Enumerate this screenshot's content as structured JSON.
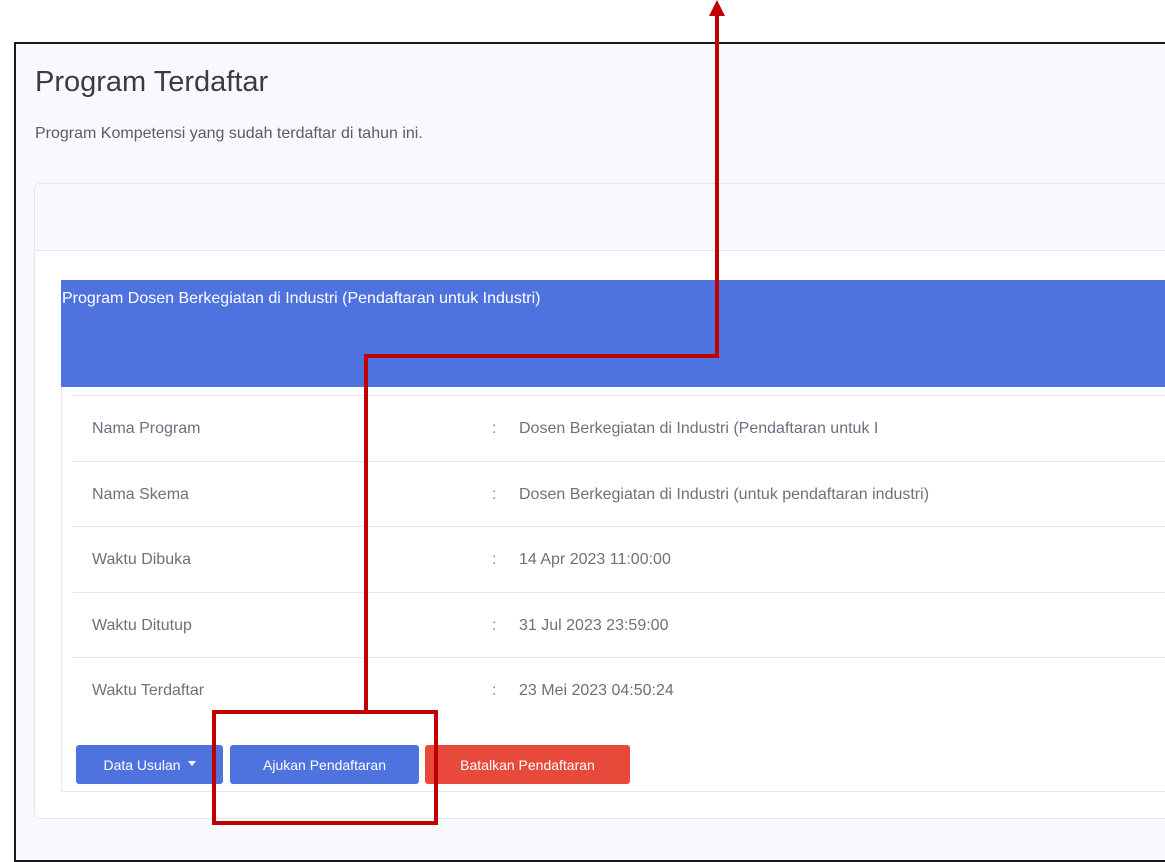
{
  "page": {
    "title": "Program Terdaftar",
    "subtitle": "Program Kompetensi yang sudah terdaftar di tahun ini."
  },
  "program_card": {
    "header_title": "Program Dosen Berkegiatan di Industri (Pendaftaran untuk Industri)",
    "separator": ":",
    "rows": [
      {
        "label": "Nama Program",
        "value": "Dosen Berkegiatan di Industri (Pendaftaran untuk I"
      },
      {
        "label": "Nama Skema",
        "value": "Dosen Berkegiatan di Industri (untuk pendaftaran industri)"
      },
      {
        "label": "Waktu Dibuka",
        "value": "14 Apr 2023 11:00:00"
      },
      {
        "label": "Waktu Ditutup",
        "value": "31 Jul 2023 23:59:00"
      },
      {
        "label": "Waktu Terdaftar",
        "value": "23 Mei 2023 04:50:24"
      }
    ]
  },
  "actions": {
    "data_usulan_label": "Data Usulan",
    "ajukan_label": "Ajukan Pendaftaran",
    "batalkan_label": "Batalkan Pendaftaran"
  },
  "colors": {
    "primary": "#4e73df",
    "danger": "#e74a3b",
    "annotation": "#c00000"
  }
}
